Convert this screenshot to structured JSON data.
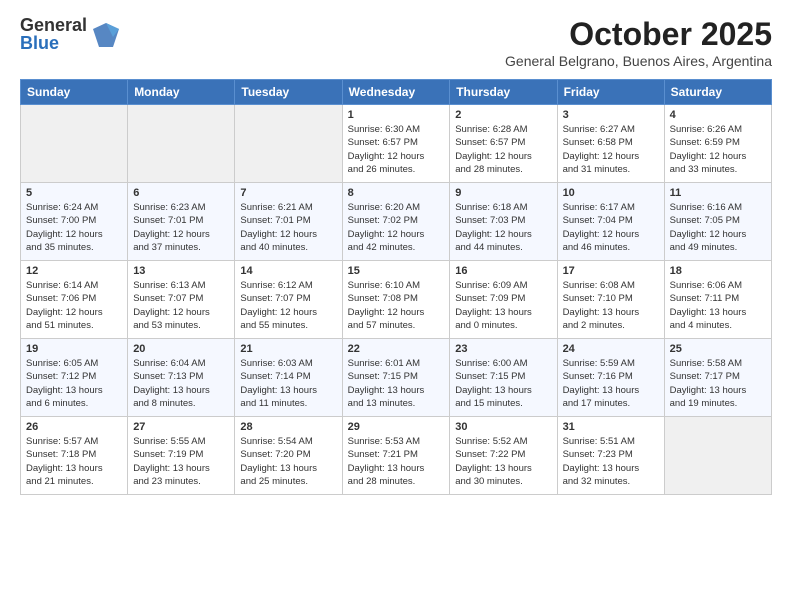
{
  "logo": {
    "general": "General",
    "blue": "Blue"
  },
  "header": {
    "month": "October 2025",
    "location": "General Belgrano, Buenos Aires, Argentina"
  },
  "weekdays": [
    "Sunday",
    "Monday",
    "Tuesday",
    "Wednesday",
    "Thursday",
    "Friday",
    "Saturday"
  ],
  "weeks": [
    [
      {
        "date": "",
        "info": ""
      },
      {
        "date": "",
        "info": ""
      },
      {
        "date": "",
        "info": ""
      },
      {
        "date": "1",
        "info": "Sunrise: 6:30 AM\nSunset: 6:57 PM\nDaylight: 12 hours\nand 26 minutes."
      },
      {
        "date": "2",
        "info": "Sunrise: 6:28 AM\nSunset: 6:57 PM\nDaylight: 12 hours\nand 28 minutes."
      },
      {
        "date": "3",
        "info": "Sunrise: 6:27 AM\nSunset: 6:58 PM\nDaylight: 12 hours\nand 31 minutes."
      },
      {
        "date": "4",
        "info": "Sunrise: 6:26 AM\nSunset: 6:59 PM\nDaylight: 12 hours\nand 33 minutes."
      }
    ],
    [
      {
        "date": "5",
        "info": "Sunrise: 6:24 AM\nSunset: 7:00 PM\nDaylight: 12 hours\nand 35 minutes."
      },
      {
        "date": "6",
        "info": "Sunrise: 6:23 AM\nSunset: 7:01 PM\nDaylight: 12 hours\nand 37 minutes."
      },
      {
        "date": "7",
        "info": "Sunrise: 6:21 AM\nSunset: 7:01 PM\nDaylight: 12 hours\nand 40 minutes."
      },
      {
        "date": "8",
        "info": "Sunrise: 6:20 AM\nSunset: 7:02 PM\nDaylight: 12 hours\nand 42 minutes."
      },
      {
        "date": "9",
        "info": "Sunrise: 6:18 AM\nSunset: 7:03 PM\nDaylight: 12 hours\nand 44 minutes."
      },
      {
        "date": "10",
        "info": "Sunrise: 6:17 AM\nSunset: 7:04 PM\nDaylight: 12 hours\nand 46 minutes."
      },
      {
        "date": "11",
        "info": "Sunrise: 6:16 AM\nSunset: 7:05 PM\nDaylight: 12 hours\nand 49 minutes."
      }
    ],
    [
      {
        "date": "12",
        "info": "Sunrise: 6:14 AM\nSunset: 7:06 PM\nDaylight: 12 hours\nand 51 minutes."
      },
      {
        "date": "13",
        "info": "Sunrise: 6:13 AM\nSunset: 7:07 PM\nDaylight: 12 hours\nand 53 minutes."
      },
      {
        "date": "14",
        "info": "Sunrise: 6:12 AM\nSunset: 7:07 PM\nDaylight: 12 hours\nand 55 minutes."
      },
      {
        "date": "15",
        "info": "Sunrise: 6:10 AM\nSunset: 7:08 PM\nDaylight: 12 hours\nand 57 minutes."
      },
      {
        "date": "16",
        "info": "Sunrise: 6:09 AM\nSunset: 7:09 PM\nDaylight: 13 hours\nand 0 minutes."
      },
      {
        "date": "17",
        "info": "Sunrise: 6:08 AM\nSunset: 7:10 PM\nDaylight: 13 hours\nand 2 minutes."
      },
      {
        "date": "18",
        "info": "Sunrise: 6:06 AM\nSunset: 7:11 PM\nDaylight: 13 hours\nand 4 minutes."
      }
    ],
    [
      {
        "date": "19",
        "info": "Sunrise: 6:05 AM\nSunset: 7:12 PM\nDaylight: 13 hours\nand 6 minutes."
      },
      {
        "date": "20",
        "info": "Sunrise: 6:04 AM\nSunset: 7:13 PM\nDaylight: 13 hours\nand 8 minutes."
      },
      {
        "date": "21",
        "info": "Sunrise: 6:03 AM\nSunset: 7:14 PM\nDaylight: 13 hours\nand 11 minutes."
      },
      {
        "date": "22",
        "info": "Sunrise: 6:01 AM\nSunset: 7:15 PM\nDaylight: 13 hours\nand 13 minutes."
      },
      {
        "date": "23",
        "info": "Sunrise: 6:00 AM\nSunset: 7:15 PM\nDaylight: 13 hours\nand 15 minutes."
      },
      {
        "date": "24",
        "info": "Sunrise: 5:59 AM\nSunset: 7:16 PM\nDaylight: 13 hours\nand 17 minutes."
      },
      {
        "date": "25",
        "info": "Sunrise: 5:58 AM\nSunset: 7:17 PM\nDaylight: 13 hours\nand 19 minutes."
      }
    ],
    [
      {
        "date": "26",
        "info": "Sunrise: 5:57 AM\nSunset: 7:18 PM\nDaylight: 13 hours\nand 21 minutes."
      },
      {
        "date": "27",
        "info": "Sunrise: 5:55 AM\nSunset: 7:19 PM\nDaylight: 13 hours\nand 23 minutes."
      },
      {
        "date": "28",
        "info": "Sunrise: 5:54 AM\nSunset: 7:20 PM\nDaylight: 13 hours\nand 25 minutes."
      },
      {
        "date": "29",
        "info": "Sunrise: 5:53 AM\nSunset: 7:21 PM\nDaylight: 13 hours\nand 28 minutes."
      },
      {
        "date": "30",
        "info": "Sunrise: 5:52 AM\nSunset: 7:22 PM\nDaylight: 13 hours\nand 30 minutes."
      },
      {
        "date": "31",
        "info": "Sunrise: 5:51 AM\nSunset: 7:23 PM\nDaylight: 13 hours\nand 32 minutes."
      },
      {
        "date": "",
        "info": ""
      }
    ]
  ]
}
